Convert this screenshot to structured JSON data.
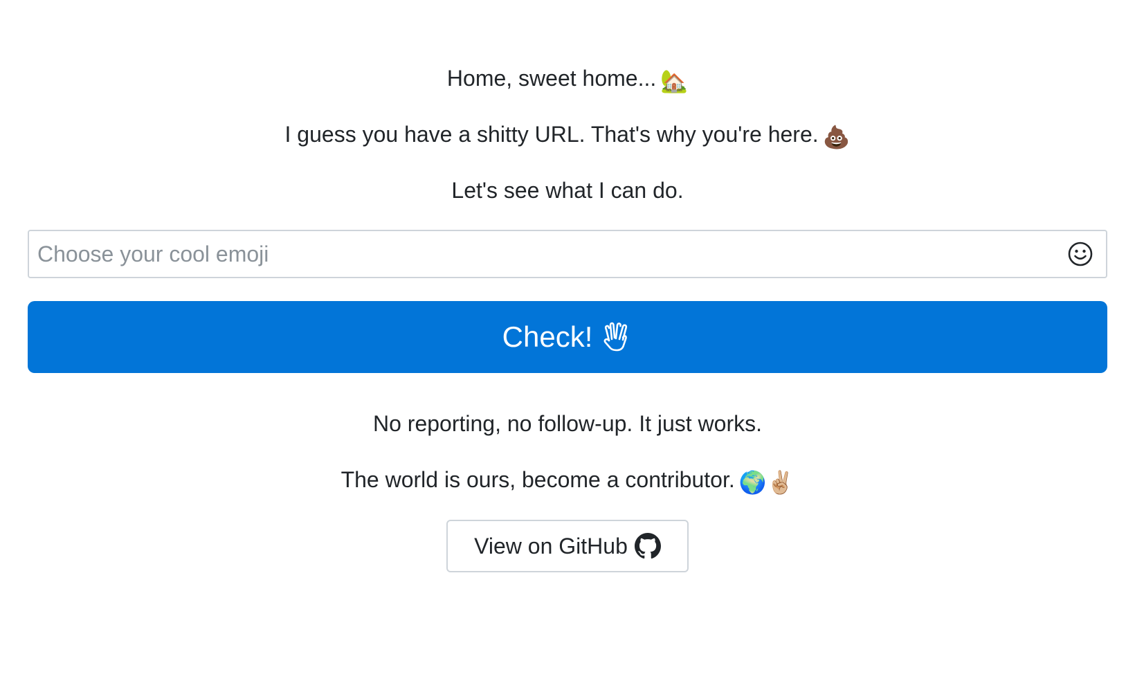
{
  "intro": {
    "line1": "Home, sweet home...",
    "line1_emoji": "🏡",
    "line2": "I guess you have a shitty URL. That's why you're here.",
    "line2_emoji": "💩",
    "line3": "Let's see what I can do."
  },
  "form": {
    "placeholder": "Choose your cool emoji",
    "value": "",
    "emoji_picker_icon": "smiley-icon",
    "submit_label": "Check!",
    "submit_icon": "vulcan-salute-icon",
    "submit_color": "#0275d8"
  },
  "footer": {
    "line1": "No reporting, no follow-up. It just works.",
    "line2": "The world is ours, become a contributor.",
    "line2_emoji": "🌍✌🏼",
    "github_label": "View on GitHub",
    "github_icon": "github-icon"
  }
}
